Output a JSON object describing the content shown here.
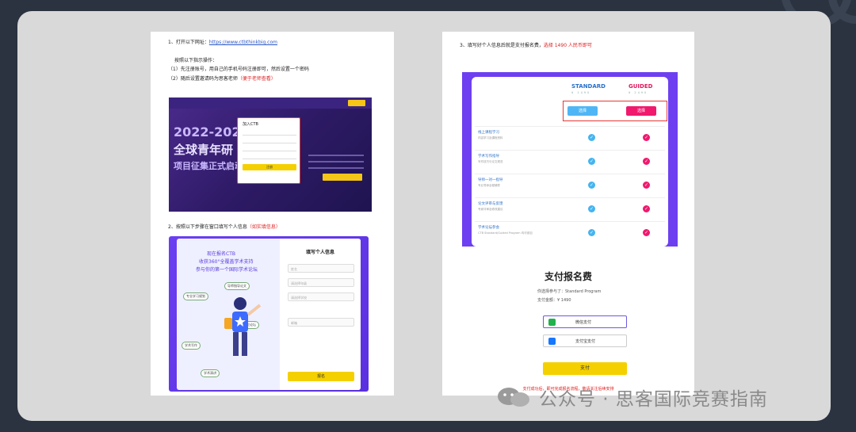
{
  "left_page": {
    "step1": {
      "prefix": "1、打开以下网址：",
      "url": "https://www.ctbthinkbig.com",
      "instruction": "按照以下指示操作：",
      "item1": "（1）先注册账号，用自己的手机号码注册即可，然后设置一个密码",
      "item2_prefix": "（2）随后设置邀请码为思客老师",
      "item2_note": "（便于老师查看）"
    },
    "screenshot1": {
      "title_line1": "2022-2023 CTB",
      "title_line2": "全球青年研",
      "title_line3": "项目征集正式启动",
      "modal_title": "加入CTB",
      "modal_button": "注册"
    },
    "step2": {
      "prefix": "2、按照以下步骤在窗口填写个人信息",
      "note": "（如实填信息）"
    },
    "screenshot2": {
      "left_line1": "现在报名CTB",
      "left_line2": "收获360°全覆盖学术支持",
      "left_line3": "参与你的第一个国际学术论坛",
      "form_title": "填写个人信息",
      "fields": [
        "姓名",
        "请选择年级",
        "请选择学校",
        "邮箱"
      ],
      "bubbles": [
        "导师指导论文",
        "专业学习规划",
        "学术写作",
        "全球青年研究论坛",
        "学术演讲"
      ],
      "submit": "报名"
    }
  },
  "right_page": {
    "step3": {
      "prefix": "3、填写好个人信息后就是支付报名费，",
      "note": "选择 1490 人民币即可"
    },
    "screenshot3": {
      "plan_standard": "STANDARD",
      "plan_guided": "GUIDED",
      "price_standard": "¥ 1490",
      "price_guided": "¥ 2490",
      "select_label": "选择",
      "rows": [
        {
          "title": "线上课程学习",
          "desc": "内容学习及课程资料"
        },
        {
          "title": "学术写作指导",
          "desc": "写作技巧与论文规范"
        },
        {
          "title": "导师一对一指导",
          "desc": "专业导师全程辅导"
        },
        {
          "title": "论文评审与反馈",
          "desc": "专家评审及修改建议"
        },
        {
          "title": "学术论坛参会",
          "desc": "CTB Standard/Guided Program 均可参加"
        }
      ]
    },
    "payment": {
      "title": "支付报名费",
      "program_line": "你选择参与了：Standard Program",
      "amount_line": "支付金额：¥ 1490",
      "wechat": "微信支付",
      "alipay": "支付宝支付",
      "pay_button": "支付",
      "note": "支付成功后，即可完成报名流程，敬请关注后续安排"
    }
  },
  "watermark": {
    "text": "公众号 · 思客国际竞赛指南"
  },
  "colors": {
    "background": "#2b3340",
    "frame": "#d9d9d9",
    "accent_red": "#e02020",
    "ctb_purple": "#6d3ff0",
    "yellow": "#f5d000"
  }
}
